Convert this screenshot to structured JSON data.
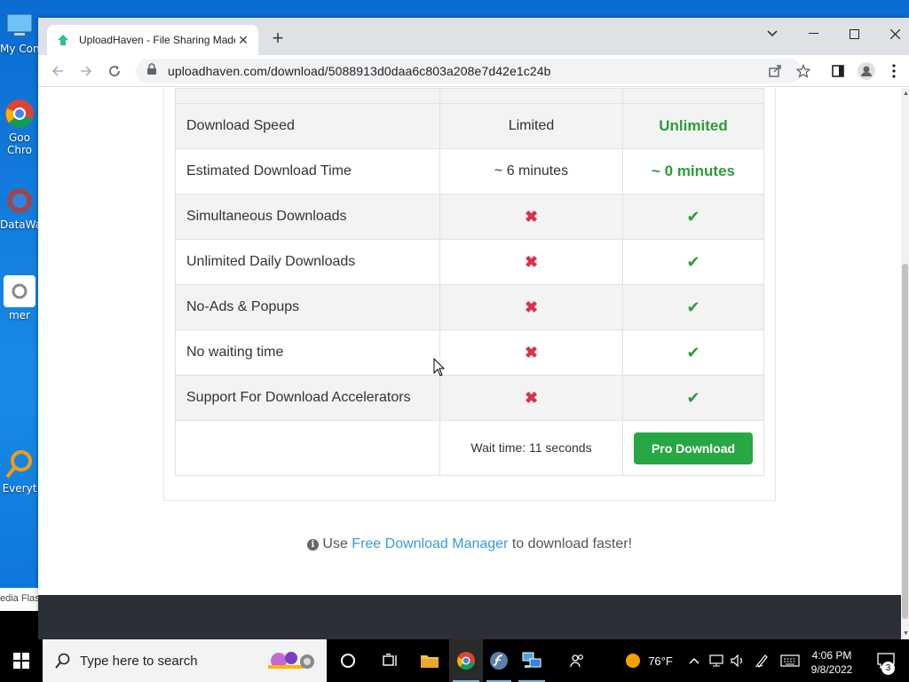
{
  "desktop": {
    "icons": [
      {
        "label": "My Con",
        "icon": "computer-icon"
      },
      {
        "label": "Goo Chro",
        "icon": "chrome-icon"
      },
      {
        "label": "DataWa",
        "icon": "datawarrior-icon"
      },
      {
        "label": "mer",
        "icon": "settings-file-icon"
      },
      {
        "label": "Everyt",
        "icon": "everything-search-icon"
      }
    ],
    "flash_label": "edia Flas"
  },
  "browser": {
    "tab_title": "UploadHaven - File Sharing Made",
    "url": "uploadhaven.com/download/5088913d0daa6c803a208e7d42e1c24b"
  },
  "comparison": {
    "rows": [
      {
        "feature": "Download Speed",
        "free": "Limited",
        "pro": "Unlimited",
        "kind": "text"
      },
      {
        "feature": "Estimated Download Time",
        "free": "~ 6 minutes",
        "pro": "~ 0 minutes",
        "kind": "text"
      },
      {
        "feature": "Simultaneous Downloads",
        "free": "✖",
        "pro": "✔",
        "kind": "icon"
      },
      {
        "feature": "Unlimited Daily Downloads",
        "free": "✖",
        "pro": "✔",
        "kind": "icon"
      },
      {
        "feature": "No-Ads & Popups",
        "free": "✖",
        "pro": "✔",
        "kind": "icon"
      },
      {
        "feature": "No waiting time",
        "free": "✖",
        "pro": "✔",
        "kind": "icon"
      },
      {
        "feature": "Support For Download Accelerators",
        "free": "✖",
        "pro": "✔",
        "kind": "icon"
      }
    ],
    "wait_text": "Wait time: 11 seconds",
    "pro_button": "Pro Download"
  },
  "fdm": {
    "prefix": "Use",
    "link": "Free Download Manager",
    "suffix": "to download faster!"
  },
  "taskbar": {
    "search_placeholder": "Type here to search",
    "weather": "76°F",
    "time": "4:06 PM",
    "date": "9/8/2022",
    "notifications": "3"
  },
  "colors": {
    "accent_green": "#28a745",
    "cross_red": "#d9334a",
    "link_blue": "#3a9ad9"
  }
}
